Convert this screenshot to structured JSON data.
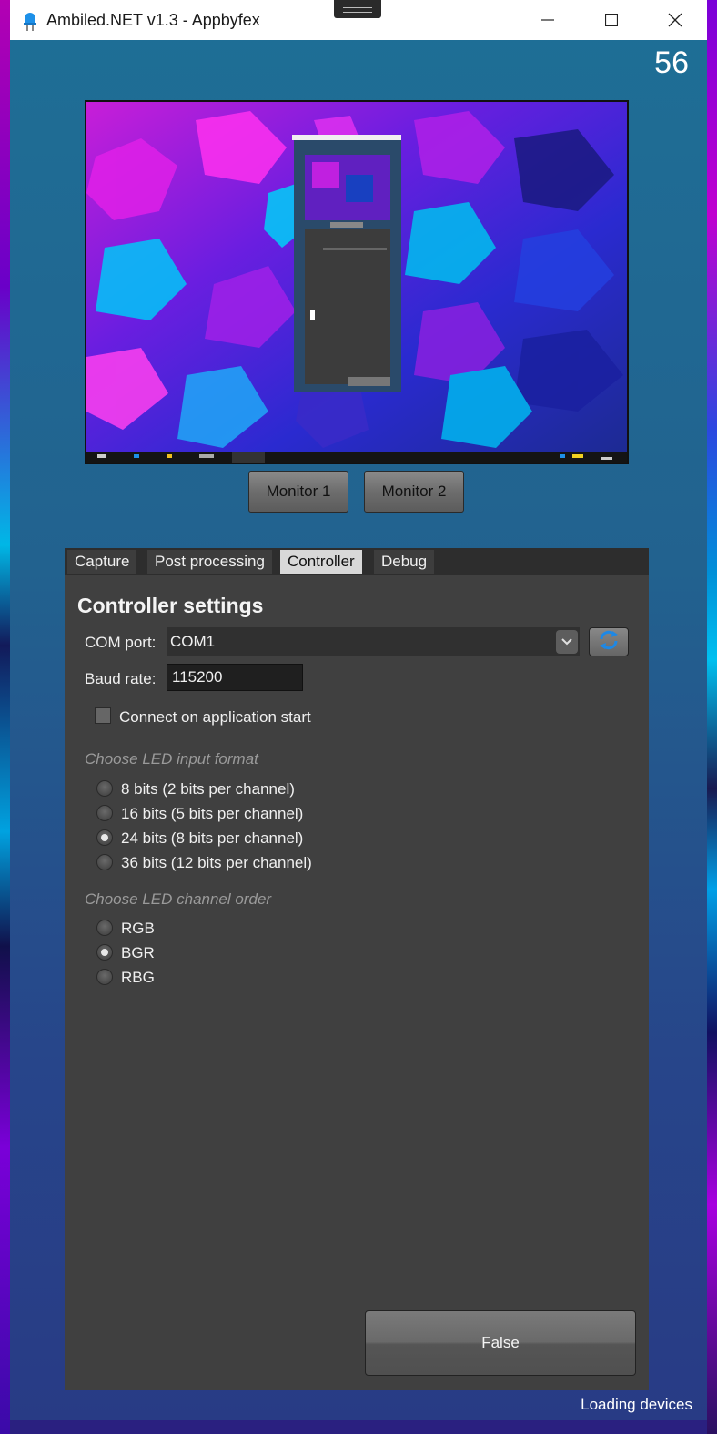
{
  "window": {
    "title": "Ambiled.NET v1.3 - Appbyfex",
    "controls": [
      "minimize-icon",
      "maximize-icon",
      "close-icon"
    ]
  },
  "fps_counter": "56",
  "monitors": [
    "Monitor 1",
    "Monitor 2"
  ],
  "tabs": [
    {
      "label": "Capture",
      "active": false
    },
    {
      "label": "Post processing",
      "active": false
    },
    {
      "label": "Controller",
      "active": true
    },
    {
      "label": "Debug",
      "active": false
    }
  ],
  "controller": {
    "title": "Controller settings",
    "com_port_label": "COM port:",
    "com_port_value": "COM1",
    "baud_rate_label": "Baud rate:",
    "baud_rate_value": "115200",
    "connect_on_start_label": "Connect on application start",
    "connect_on_start_checked": false,
    "led_format": {
      "heading": "Choose LED input format",
      "options": [
        "8 bits (2 bits per channel)",
        "16 bits (5 bits per channel)",
        "24 bits (8 bits per channel)",
        "36 bits (12 bits per channel)"
      ],
      "selected": "24 bits (8 bits per channel)"
    },
    "channel_order": {
      "heading": "Choose LED channel order",
      "options": [
        "RGB",
        "BGR",
        "RBG"
      ],
      "selected": "BGR"
    },
    "toggle_button_label": "False"
  },
  "status_text": "Loading devices",
  "colors": {
    "window_bg": "#1e6f96",
    "panel_bg": "#404040",
    "tab_active_bg": "#d8d8d8",
    "accent_refresh": "#1e88e5"
  }
}
